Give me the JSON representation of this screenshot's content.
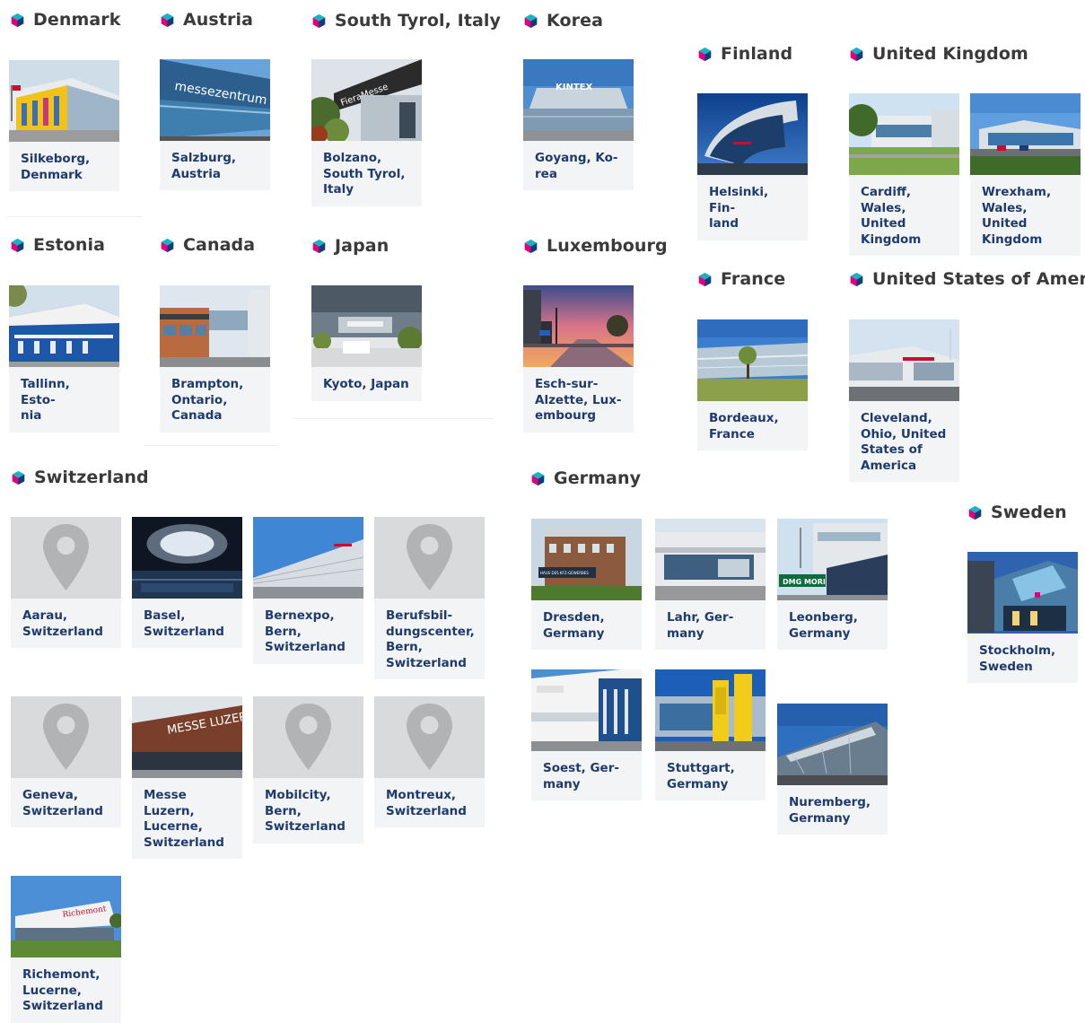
{
  "colors": {
    "label": "#1f3a6d",
    "heading": "#3a3a3a",
    "card_bg": "#f3f4f6",
    "cube_left": "#e2007a",
    "cube_right": "#0f3d7a",
    "cube_top": "#19b1c6"
  },
  "regions": {
    "denmark": {
      "title": "Denmark",
      "locations": [
        "Silkeborg,\nDenmark"
      ]
    },
    "austria": {
      "title": "Austria",
      "locations": [
        "Salzburg,\nAustria"
      ]
    },
    "south_tyrol": {
      "title": "South Tyrol, Italy",
      "locations": [
        "Bolzano,\nSouth Tyrol,\nItaly"
      ]
    },
    "korea": {
      "title": "Korea",
      "locations": [
        "Goyang, Ko-\nrea"
      ]
    },
    "finland": {
      "title": "Finland",
      "locations": [
        "Helsinki, Fin-\nland"
      ]
    },
    "uk": {
      "title": "United Kingdom",
      "locations": [
        "Cardiff,\nWales, United\nKingdom",
        "Wrexham,\nWales, United\nKingdom"
      ]
    },
    "estonia": {
      "title": "Estonia",
      "locations": [
        "Tallinn, Esto-\nnia"
      ]
    },
    "canada": {
      "title": "Canada",
      "locations": [
        "Brampton,\nOntario,\nCanada"
      ]
    },
    "japan": {
      "title": "Japan",
      "locations": [
        "Kyoto, Japan"
      ]
    },
    "luxembourg": {
      "title": "Luxembourg",
      "locations": [
        "Esch-sur-\nAlzette, Lux-\nembourg"
      ]
    },
    "france": {
      "title": "France",
      "locations": [
        "Bordeaux,\nFrance"
      ]
    },
    "usa": {
      "title": "United States of America",
      "locations": [
        "Cleveland,\nOhio, United\nStates of\nAmerica"
      ]
    },
    "switzerland": {
      "title": "Switzerland",
      "locations": [
        "Aarau,\nSwitzerland",
        "Basel,\nSwitzerland",
        "Bernexpo,\nBern,\nSwitzerland",
        "Berufsbil-\ndungscenter,\nBern,\nSwitzerland",
        "Geneva,\nSwitzerland",
        "Messe\nLuzern,\nLucerne,\nSwitzerland",
        "Mobilcity,\nBern,\nSwitzerland",
        "Montreux,\nSwitzerland",
        "Richemont,\nLucerne,\nSwitzerland"
      ]
    },
    "germany": {
      "title": "Germany",
      "locations": [
        "Dresden,\nGermany",
        "Lahr, Ger-\nmany",
        "Leonberg,\nGermany",
        "Soest, Ger-\nmany",
        "Stuttgart,\nGermany",
        "Nuremberg,\nGermany"
      ]
    },
    "sweden": {
      "title": "Sweden",
      "locations": [
        "Stockholm,\nSweden"
      ]
    }
  },
  "photo_signage": {
    "austria": "messezentrum",
    "south_tyrol": "FieraMesse",
    "korea": "KINTEX",
    "dresden": "HAUS DES KFZ-GEWERBES",
    "leonberg": "DMG MORI",
    "messe_luzern": "MESSE LUZERN",
    "richemont": "Richemont"
  }
}
